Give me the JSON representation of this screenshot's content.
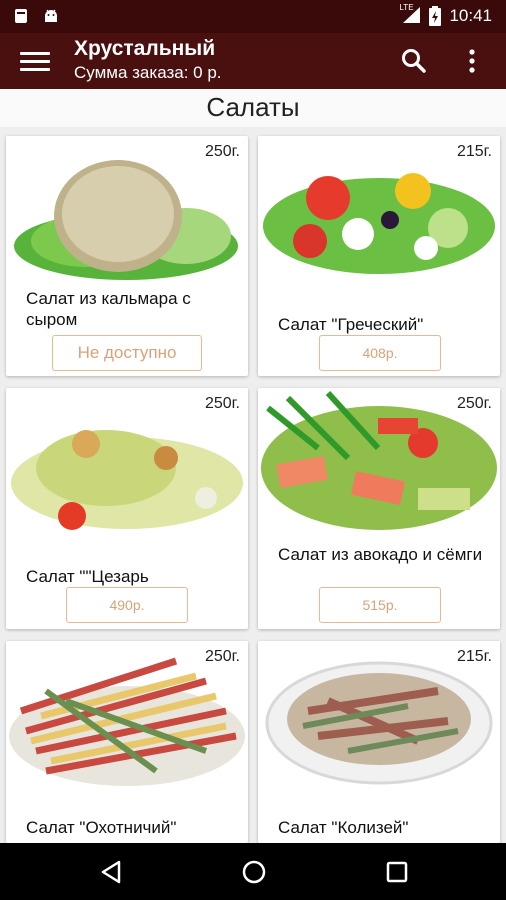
{
  "status_bar": {
    "time": "10:41",
    "network": "LTE",
    "icons": [
      "notification-icon",
      "android-icon",
      "lte-signal-icon",
      "battery-charging-icon"
    ]
  },
  "app_bar": {
    "title": "Хрустальный",
    "subtitle": "Сумма заказа: 0 р.",
    "icons": [
      "menu-icon",
      "search-icon",
      "more-vert-icon"
    ]
  },
  "section": {
    "title": "Салаты"
  },
  "products": [
    {
      "name": "Салат из кальмара с сыром",
      "weight": "250г.",
      "price": "Не доступно",
      "available": false
    },
    {
      "name": "Салат \"Греческий\"",
      "weight": "215г.",
      "price": "408р.",
      "available": true
    },
    {
      "name": "Салат \"\"Цезарь",
      "weight": "250г.",
      "price": "490р.",
      "available": true
    },
    {
      "name": "Салат из авокадо и сёмги",
      "weight": "250г.",
      "price": "515р.",
      "available": true
    },
    {
      "name": "Салат \"Охотничий\"",
      "weight": "250г.",
      "price": "",
      "available": true
    },
    {
      "name": "Салат \"Колизей\"",
      "weight": "215г.",
      "price": "",
      "available": true
    }
  ],
  "nav_bar": {
    "icons": [
      "back-icon",
      "home-icon",
      "recents-icon"
    ]
  }
}
